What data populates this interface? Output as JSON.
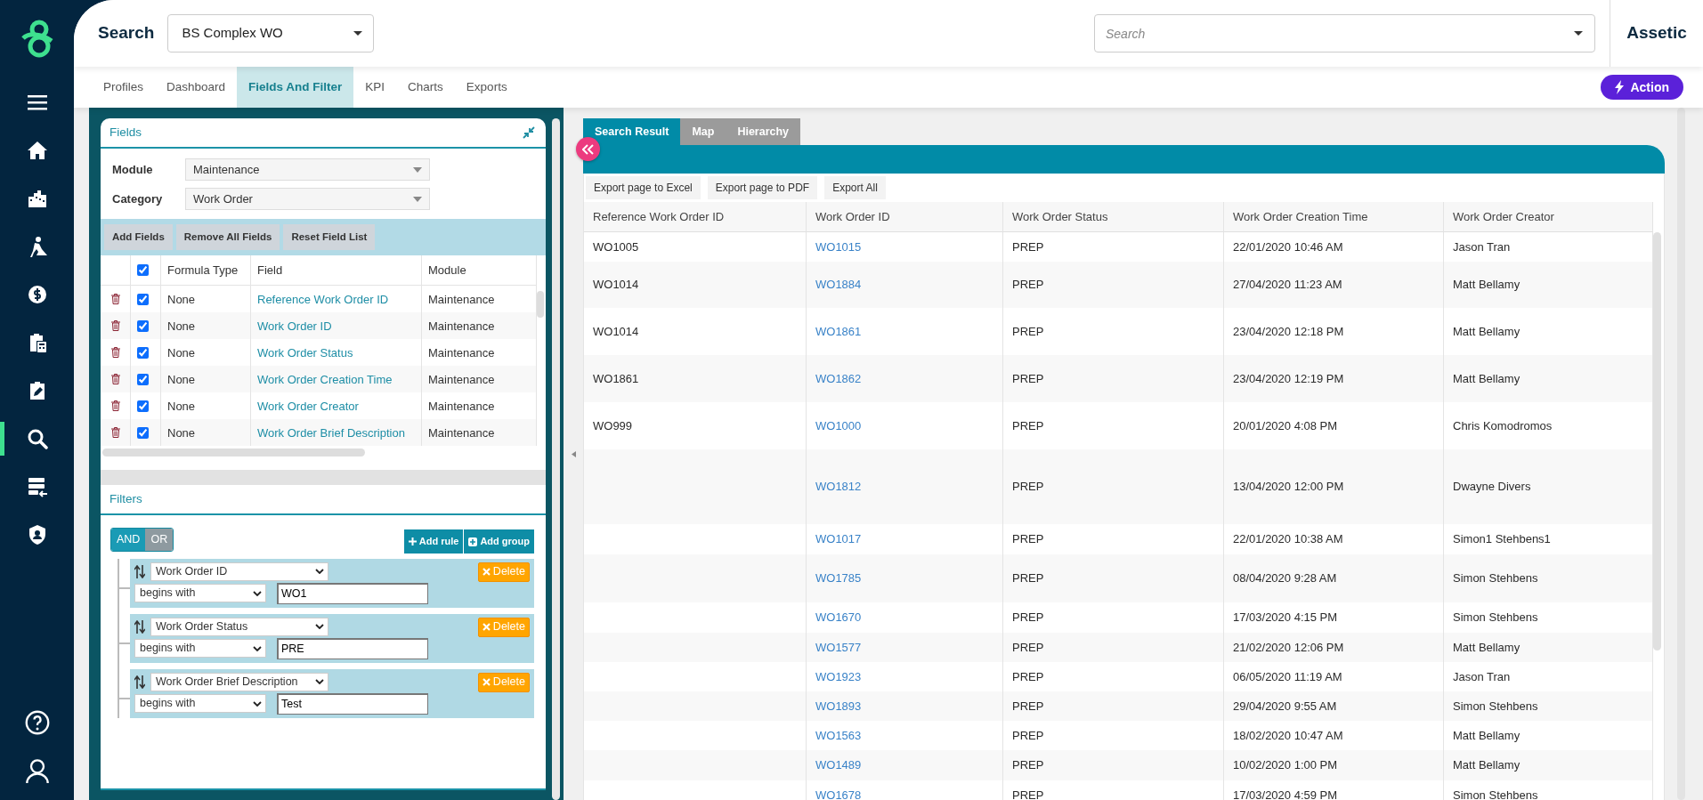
{
  "sidebar": {
    "items": [
      {
        "kind": "menu",
        "selected": false
      },
      {
        "kind": "home",
        "selected": false
      },
      {
        "kind": "buildings",
        "selected": false
      },
      {
        "kind": "worker",
        "selected": false
      },
      {
        "kind": "dollar",
        "selected": false
      },
      {
        "kind": "calculator",
        "selected": false
      },
      {
        "kind": "edit",
        "selected": false
      },
      {
        "kind": "search",
        "selected": true
      },
      {
        "kind": "server",
        "selected": false
      },
      {
        "kind": "shield",
        "selected": false
      }
    ],
    "bottom_items": [
      {
        "kind": "help"
      },
      {
        "kind": "user"
      }
    ]
  },
  "header": {
    "title": "Search",
    "profile_select": {
      "value": "BS Complex WO"
    },
    "search": {
      "placeholder": "Search"
    },
    "brand": "Assetic"
  },
  "tabs": [
    {
      "label": "Profiles",
      "selected": false
    },
    {
      "label": "Dashboard",
      "selected": false
    },
    {
      "label": "Fields And Filter",
      "selected": true
    },
    {
      "label": "KPI",
      "selected": false
    },
    {
      "label": "Charts",
      "selected": false
    },
    {
      "label": "Exports",
      "selected": false
    }
  ],
  "action_button": "Action",
  "fields_panel": {
    "title": "Fields",
    "selects": [
      {
        "label": "Module",
        "value": "Maintenance"
      },
      {
        "label": "Category",
        "value": "Work Order"
      }
    ],
    "buttons": [
      "Add Fields",
      "Remove All Fields",
      "Reset Field List"
    ],
    "all_checked": true,
    "columns": [
      "Formula Type",
      "Field",
      "Module"
    ],
    "rows": [
      {
        "checked": true,
        "formula_type": "None",
        "field": "Reference Work Order ID",
        "module": "Maintenance"
      },
      {
        "checked": true,
        "formula_type": "None",
        "field": "Work Order ID",
        "module": "Maintenance"
      },
      {
        "checked": true,
        "formula_type": "None",
        "field": "Work Order Status",
        "module": "Maintenance"
      },
      {
        "checked": true,
        "formula_type": "None",
        "field": "Work Order Creation Time",
        "module": "Maintenance"
      },
      {
        "checked": true,
        "formula_type": "None",
        "field": "Work Order Creator",
        "module": "Maintenance"
      },
      {
        "checked": true,
        "formula_type": "None",
        "field": "Work Order Brief Description",
        "module": "Maintenance"
      }
    ]
  },
  "filters_panel": {
    "title": "Filters",
    "conjunctions": [
      {
        "label": "AND",
        "selected": true
      },
      {
        "label": "OR",
        "selected": false
      }
    ],
    "buttons": [
      {
        "kind": "rule",
        "label": "Add rule"
      },
      {
        "kind": "group",
        "label": "Add group"
      }
    ],
    "rules": [
      {
        "field": "Work Order ID",
        "operator": "begins with",
        "value": "WO1",
        "delete_label": "Delete"
      },
      {
        "field": "Work Order Status",
        "operator": "begins with",
        "value": "PRE",
        "delete_label": "Delete"
      },
      {
        "field": "Work Order Brief Description",
        "operator": "begins with",
        "value": "Test",
        "delete_label": "Delete"
      }
    ]
  },
  "results": {
    "tabs": [
      {
        "label": "Search Result",
        "selected": true
      },
      {
        "label": "Map",
        "selected": false
      },
      {
        "label": "Hierarchy",
        "selected": false
      }
    ],
    "export_buttons": [
      "Export page to Excel",
      "Export page to PDF",
      "Export All"
    ],
    "table": {
      "columns": [
        "Reference Work Order ID",
        "Work Order ID",
        "Work Order Status",
        "Work Order Creation Time",
        "Work Order Creator"
      ],
      "rows": [
        {
          "reference_id": "WO1005",
          "work_order_id": "WO1015",
          "status": "PREP",
          "creation_time": "22/01/2020 10:46 AM",
          "creator": "Jason Tran"
        },
        {
          "reference_id": "WO1014",
          "work_order_id": "WO1884",
          "status": "PREP",
          "creation_time": "27/04/2020 11:23 AM",
          "creator": "Matt Bellamy"
        },
        {
          "reference_id": "WO1014",
          "work_order_id": "WO1861",
          "status": "PREP",
          "creation_time": "23/04/2020 12:18 PM",
          "creator": "Matt Bellamy"
        },
        {
          "reference_id": "WO1861",
          "work_order_id": "WO1862",
          "status": "PREP",
          "creation_time": "23/04/2020 12:19 PM",
          "creator": "Matt Bellamy"
        },
        {
          "reference_id": "WO999",
          "work_order_id": "WO1000",
          "status": "PREP",
          "creation_time": "20/01/2020 4:08 PM",
          "creator": "Chris Komodromos"
        },
        {
          "work_order_id": "WO1812",
          "status": "PREP",
          "creation_time": "13/04/2020 12:00 PM",
          "creator": "Dwayne Divers"
        },
        {
          "work_order_id": "WO1017",
          "status": "PREP",
          "creation_time": "22/01/2020 10:38 AM",
          "creator": "Simon1 Stehbens1"
        },
        {
          "work_order_id": "WO1785",
          "status": "PREP",
          "creation_time": "08/04/2020 9:28 AM",
          "creator": "Simon Stehbens"
        },
        {
          "work_order_id": "WO1670",
          "status": "PREP",
          "creation_time": "17/03/2020 4:15 PM",
          "creator": "Simon Stehbens"
        },
        {
          "work_order_id": "WO1577",
          "status": "PREP",
          "creation_time": "21/02/2020 12:06 PM",
          "creator": "Matt Bellamy"
        },
        {
          "work_order_id": "WO1923",
          "status": "PREP",
          "creation_time": "06/05/2020 11:19 AM",
          "creator": "Jason Tran"
        },
        {
          "work_order_id": "WO1893",
          "status": "PREP",
          "creation_time": "29/04/2020 9:55 AM",
          "creator": "Simon Stehbens"
        },
        {
          "work_order_id": "WO1563",
          "status": "PREP",
          "creation_time": "18/02/2020 10:47 AM",
          "creator": "Matt Bellamy"
        },
        {
          "work_order_id": "WO1489",
          "status": "PREP",
          "creation_time": "10/02/2020 1:00 PM",
          "creator": "Matt Bellamy"
        },
        {
          "work_order_id": "WO1678",
          "status": "PREP",
          "creation_time": "17/03/2020 4:59 PM",
          "creator": "Simon Stehbens"
        }
      ]
    }
  }
}
